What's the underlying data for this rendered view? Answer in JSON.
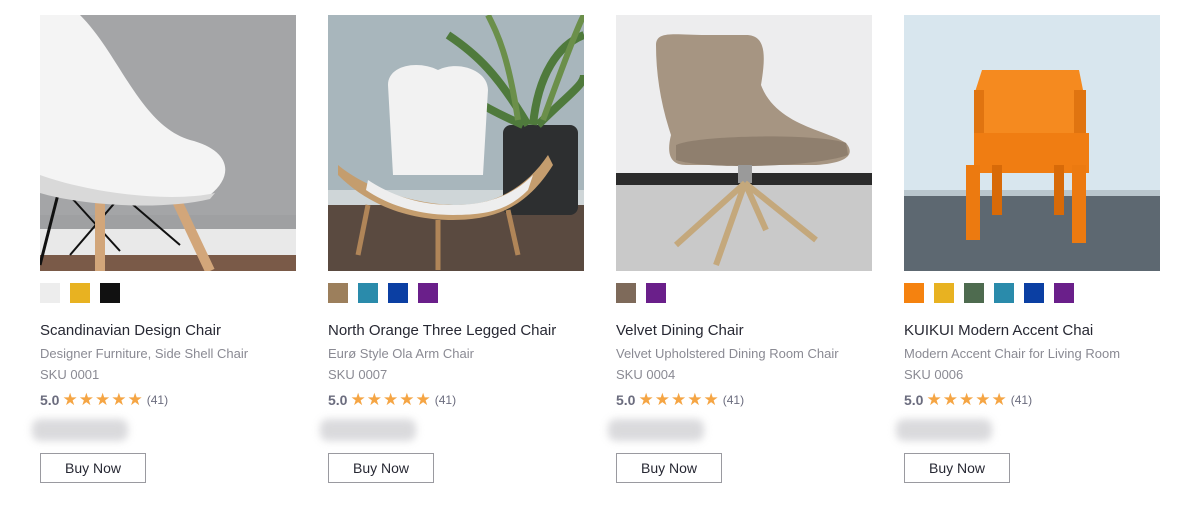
{
  "products": [
    {
      "title": "Scandinavian Design Chair",
      "subtitle": "Designer Furniture, Side Shell Chair",
      "sku": "SKU 0001",
      "rating": "5.0",
      "rating_count": "(41)",
      "stars": 5,
      "swatches": [
        "#ededed",
        "#e8b221",
        "#111111"
      ],
      "buy_label": "Buy Now"
    },
    {
      "title": "North Orange Three Legged Chair",
      "subtitle": "Eurø Style Ola Arm Chair",
      "sku": "SKU 0007",
      "rating": "5.0",
      "rating_count": "(41)",
      "stars": 5,
      "swatches": [
        "#9c7f5c",
        "#2a8bab",
        "#0b3fa3",
        "#6a1f8a"
      ],
      "buy_label": "Buy Now"
    },
    {
      "title": "Velvet Dining Chair",
      "subtitle": "Velvet Upholstered Dining Room Chair",
      "sku": "SKU 0004",
      "rating": "5.0",
      "rating_count": "(41)",
      "stars": 5,
      "swatches": [
        "#7e6a5a",
        "#6a1f8a"
      ],
      "buy_label": "Buy Now"
    },
    {
      "title": "KUIKUI Modern Accent Chai",
      "subtitle": "Modern Accent Chair for Living Room",
      "sku": "SKU 0006",
      "rating": "5.0",
      "rating_count": "(41)",
      "stars": 5,
      "swatches": [
        "#f5820f",
        "#e8b221",
        "#4e6b4f",
        "#2a8bab",
        "#0b3fa3",
        "#6a1f8a"
      ],
      "buy_label": "Buy Now"
    }
  ]
}
